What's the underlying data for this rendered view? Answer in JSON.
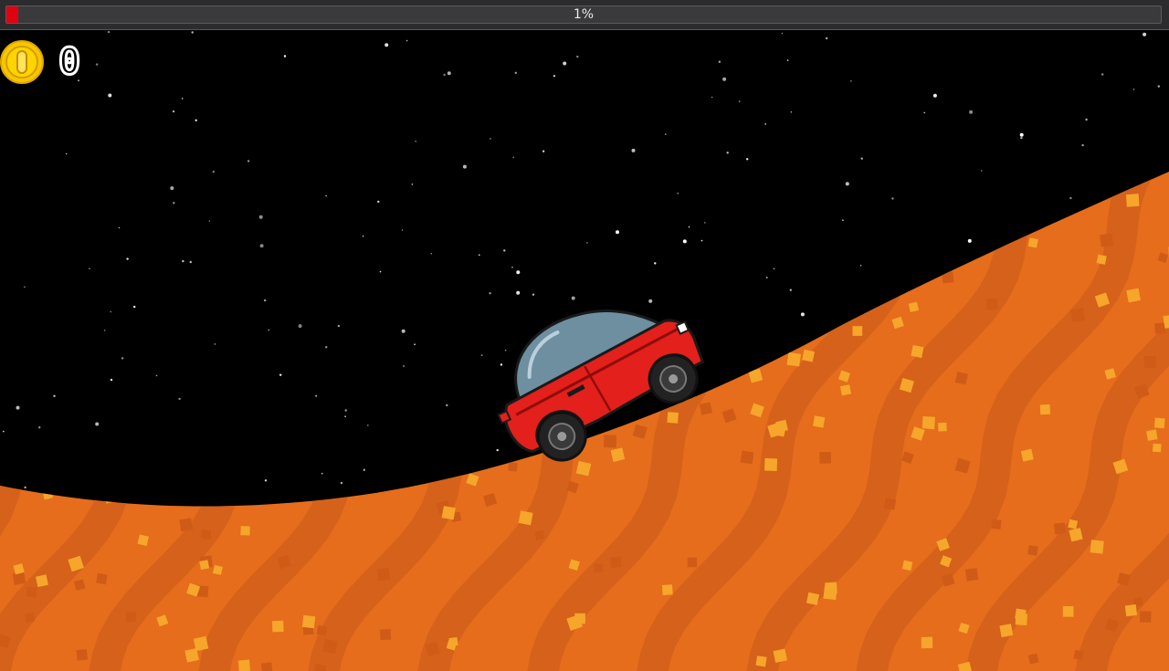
{
  "hud": {
    "progress_label": "1%",
    "progress_value": 0.01,
    "coin_count": "0",
    "coin_icon": "gold-coin-icon"
  },
  "colors": {
    "sky": "#000000",
    "ground": "#e56d1c",
    "ground_dark": "#d5611a",
    "ground_dots": "#f5a62b",
    "progress_fill": "#e00010",
    "car_body": "#e3201b",
    "car_dome": "#6d8fa0",
    "coin": "#f7c600"
  }
}
